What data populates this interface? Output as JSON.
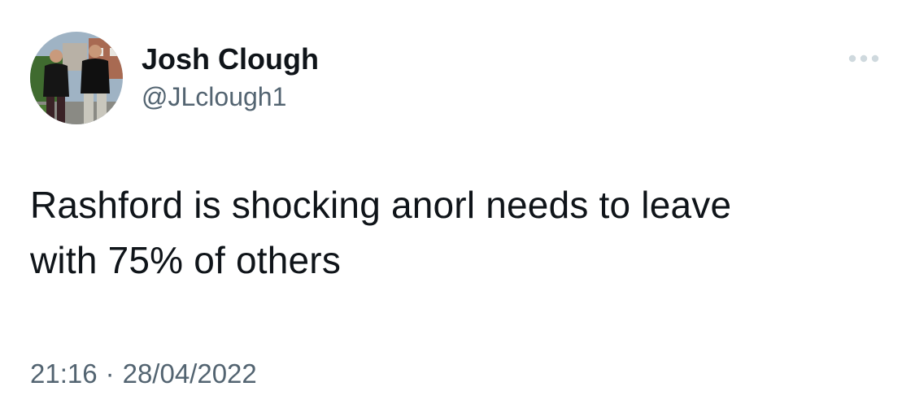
{
  "tweet": {
    "author": {
      "display_name": "Josh Clough",
      "handle": "@JLclough1",
      "avatar_icon": "profile-photo"
    },
    "more_icon": "more-horizontal-icon",
    "text_lines": [
      "Rashford is shocking anorl needs to leave",
      "with 75% of others"
    ],
    "time": "21:16",
    "separator": "·",
    "date": "28/04/2022"
  },
  "colors": {
    "text_primary": "#0f1419",
    "text_secondary": "#536471",
    "background": "#ffffff"
  }
}
